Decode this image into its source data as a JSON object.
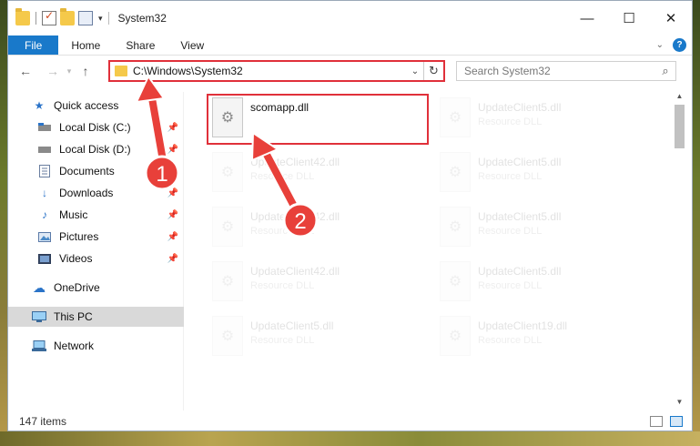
{
  "window": {
    "title": "System32"
  },
  "controls": {
    "minimize": "—",
    "maximize": "☐",
    "close": "✕"
  },
  "ribbon": {
    "tabs": [
      "File",
      "Home",
      "Share",
      "View"
    ],
    "help": "?"
  },
  "nav": {
    "back": "←",
    "forward": "→",
    "up": "↑",
    "address": "C:\\Windows\\System32",
    "search_placeholder": "Search System32"
  },
  "sidebar": {
    "items": [
      {
        "label": "Quick access",
        "icon": "star-icon"
      },
      {
        "label": "Local Disk (C:)",
        "icon": "drive-icon",
        "pinned": true
      },
      {
        "label": "Local Disk (D:)",
        "icon": "drive-icon",
        "pinned": true
      },
      {
        "label": "Documents",
        "icon": "document-icon",
        "pinned": true
      },
      {
        "label": "Downloads",
        "icon": "download-icon",
        "pinned": true
      },
      {
        "label": "Music",
        "icon": "music-icon",
        "pinned": true
      },
      {
        "label": "Pictures",
        "icon": "picture-icon",
        "pinned": true
      },
      {
        "label": "Videos",
        "icon": "video-icon",
        "pinned": true
      },
      {
        "label": "OneDrive",
        "icon": "cloud-icon"
      },
      {
        "label": "This PC",
        "icon": "computer-icon",
        "selected": true
      },
      {
        "label": "Network",
        "icon": "network-icon"
      }
    ]
  },
  "files": [
    {
      "name": "scomapp.dll",
      "type": ""
    },
    {
      "name": "UpdateClient5.dll",
      "type": "Resource DLL"
    },
    {
      "name": "UpdateClient42.dll",
      "type": "Resource DLL"
    },
    {
      "name": "UpdateClient5.dll",
      "type": "Resource DLL"
    },
    {
      "name": "UpdateClient42.dll",
      "type": "Resource DLL"
    },
    {
      "name": "UpdateClient5.dll",
      "type": "Resource DLL"
    },
    {
      "name": "UpdateClient42.dll",
      "type": "Resource DLL"
    },
    {
      "name": "UpdateClient5.dll",
      "type": "Resource DLL"
    },
    {
      "name": "UpdateClient5.dll",
      "type": "Resource DLL"
    },
    {
      "name": "UpdateClient19.dll",
      "type": "Resource DLL"
    }
  ],
  "status": {
    "count": "147 items"
  },
  "annotations": {
    "step1": "1",
    "step2": "2"
  },
  "colors": {
    "accent": "#1979ca",
    "highlight": "#e0303a"
  }
}
